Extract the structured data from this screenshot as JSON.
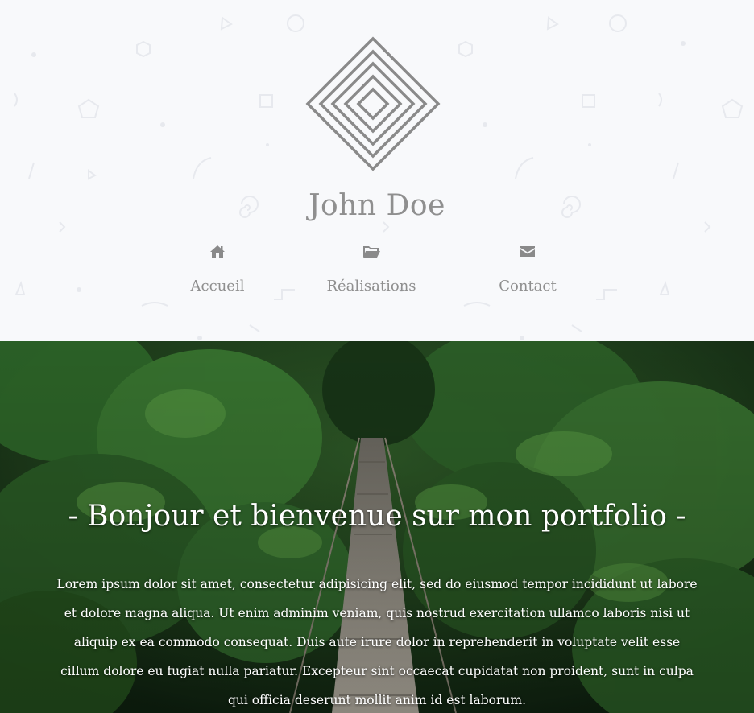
{
  "header": {
    "logo_icon": "concentric-diamond-logo",
    "site_name": "John Doe",
    "nav": [
      {
        "label": "Accueil",
        "icon": "home-icon"
      },
      {
        "label": "Réalisations",
        "icon": "folder-open-icon"
      },
      {
        "label": "Contact",
        "icon": "envelope-icon"
      }
    ]
  },
  "hero": {
    "title": "- Bonjour et bienvenue sur mon portfolio -",
    "paragraph": "Lorem ipsum dolor sit amet, consectetur adipisicing elit, sed do eiusmod tempor incididunt ut labore et dolore magna aliqua. Ut enim adminim veniam, quis nostrud exercitation ullamco laboris nisi ut aliquip ex ea commodo consequat. Duis aute irure dolor in reprehenderit in voluptate velit esse cillum dolore eu fugiat nulla pariatur. Excepteur sint occaecat cupidatat non proident, sunt in culpa qui officia deserunt mollit anim id est laborum.",
    "background": "forest-suspension-bridge-photo"
  },
  "colors": {
    "header_bg": "#f8f9fb",
    "text_gray": "#8f8f8f",
    "hero_text": "#ffffff"
  }
}
